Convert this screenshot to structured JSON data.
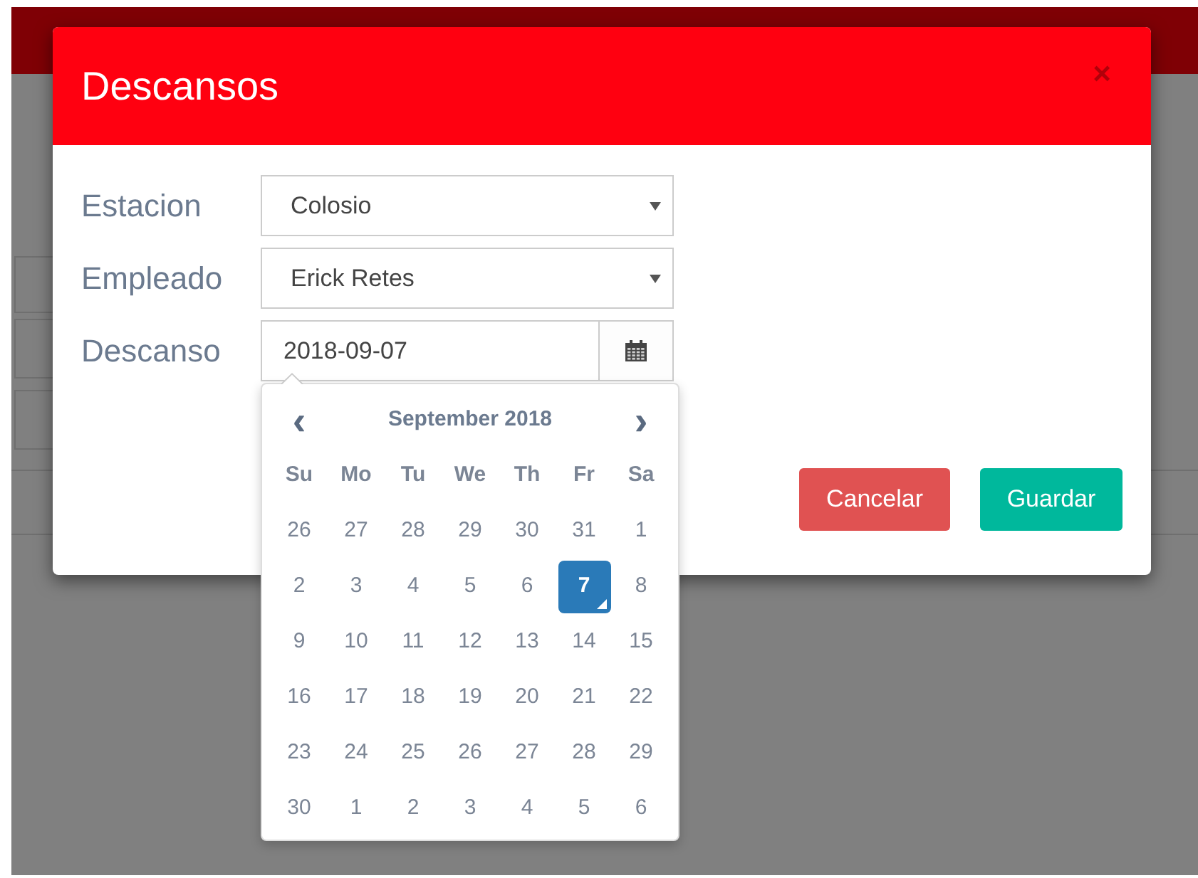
{
  "dialog": {
    "title": "Descansos",
    "close": "×",
    "fields": [
      {
        "kind": "select",
        "label": "Estacion",
        "value": "Colosio"
      },
      {
        "kind": "select",
        "label": "Empleado",
        "value": "Erick Retes"
      },
      {
        "kind": "date",
        "label": "Descanso",
        "value": "2018-09-07"
      }
    ],
    "buttons": [
      {
        "label": "Cancelar",
        "kind": "danger"
      },
      {
        "label": "Guardar",
        "kind": "success"
      }
    ]
  },
  "calendar": {
    "prev": "‹",
    "next": "›",
    "month": "September 2018",
    "weekdays": [
      "Su",
      "Mo",
      "Tu",
      "We",
      "Th",
      "Fr",
      "Sa"
    ],
    "weeks": [
      [
        {
          "label": "26",
          "selected": false,
          "today": false
        },
        {
          "label": "27",
          "selected": false,
          "today": false
        },
        {
          "label": "28",
          "selected": false,
          "today": false
        },
        {
          "label": "29",
          "selected": false,
          "today": false
        },
        {
          "label": "30",
          "selected": false,
          "today": false
        },
        {
          "label": "31",
          "selected": false,
          "today": false
        },
        {
          "label": "1",
          "selected": false,
          "today": false
        }
      ],
      [
        {
          "label": "2",
          "selected": false,
          "today": false
        },
        {
          "label": "3",
          "selected": false,
          "today": false
        },
        {
          "label": "4",
          "selected": false,
          "today": false
        },
        {
          "label": "5",
          "selected": false,
          "today": false
        },
        {
          "label": "6",
          "selected": false,
          "today": false
        },
        {
          "label": "7",
          "selected": true,
          "today": true
        },
        {
          "label": "8",
          "selected": false,
          "today": false
        }
      ],
      [
        {
          "label": "9",
          "selected": false,
          "today": false
        },
        {
          "label": "10",
          "selected": false,
          "today": false
        },
        {
          "label": "11",
          "selected": false,
          "today": false
        },
        {
          "label": "12",
          "selected": false,
          "today": false
        },
        {
          "label": "13",
          "selected": false,
          "today": false
        },
        {
          "label": "14",
          "selected": false,
          "today": false
        },
        {
          "label": "15",
          "selected": false,
          "today": false
        }
      ],
      [
        {
          "label": "16",
          "selected": false,
          "today": false
        },
        {
          "label": "17",
          "selected": false,
          "today": false
        },
        {
          "label": "18",
          "selected": false,
          "today": false
        },
        {
          "label": "19",
          "selected": false,
          "today": false
        },
        {
          "label": "20",
          "selected": false,
          "today": false
        },
        {
          "label": "21",
          "selected": false,
          "today": false
        },
        {
          "label": "22",
          "selected": false,
          "today": false
        }
      ],
      [
        {
          "label": "23",
          "selected": false,
          "today": false
        },
        {
          "label": "24",
          "selected": false,
          "today": false
        },
        {
          "label": "25",
          "selected": false,
          "today": false
        },
        {
          "label": "26",
          "selected": false,
          "today": false
        },
        {
          "label": "27",
          "selected": false,
          "today": false
        },
        {
          "label": "28",
          "selected": false,
          "today": false
        },
        {
          "label": "29",
          "selected": false,
          "today": false
        }
      ],
      [
        {
          "label": "30",
          "selected": false,
          "today": false
        },
        {
          "label": "1",
          "selected": false,
          "today": false
        },
        {
          "label": "2",
          "selected": false,
          "today": false
        },
        {
          "label": "3",
          "selected": false,
          "today": false
        },
        {
          "label": "4",
          "selected": false,
          "today": false
        },
        {
          "label": "5",
          "selected": false,
          "today": false
        },
        {
          "label": "6",
          "selected": false,
          "today": false
        }
      ]
    ]
  }
}
